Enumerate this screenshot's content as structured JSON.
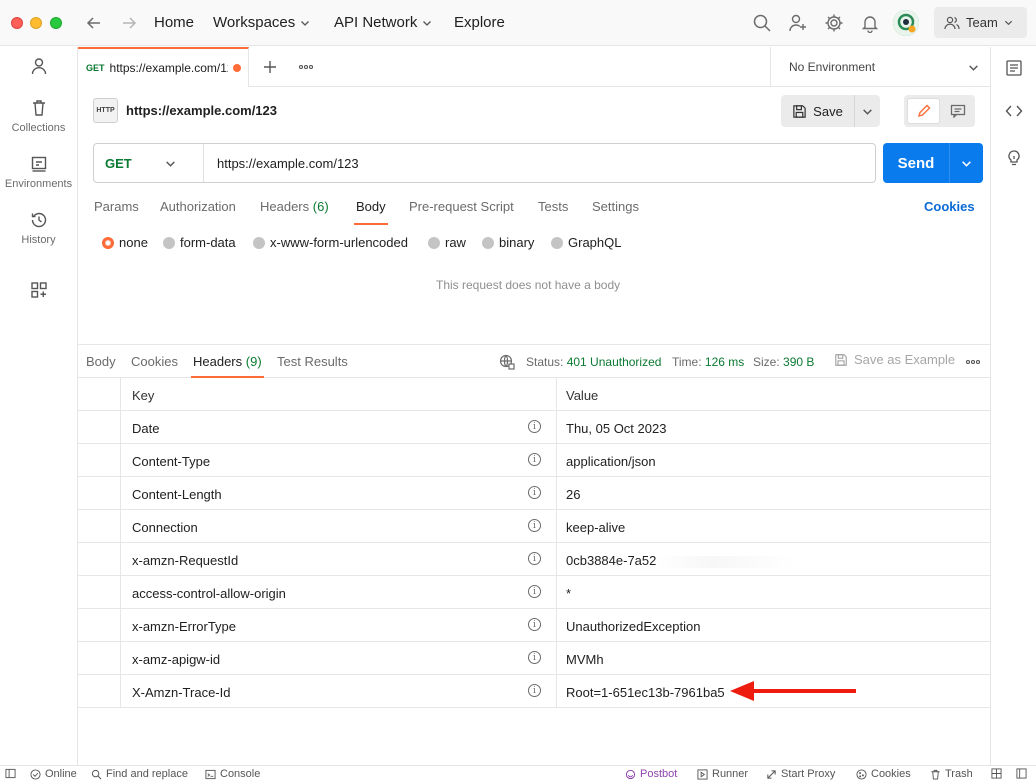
{
  "topbar": {
    "nav": [
      "Home",
      "Workspaces",
      "API Network",
      "Explore"
    ],
    "team_label": "Team"
  },
  "sidebar": {
    "items": [
      {
        "label": "Collections",
        "icon": "trash-bin-icon"
      },
      {
        "label": "Environments",
        "icon": "environment-icon"
      },
      {
        "label": "History",
        "icon": "history-icon"
      }
    ]
  },
  "tabs": {
    "active": {
      "method": "GET",
      "title": "https://example.com/123"
    },
    "environment": "No Environment"
  },
  "request": {
    "title": "https://example.com/123",
    "http_badge": "HTTP",
    "save_label": "Save",
    "method": "GET",
    "url": "https://example.com/123",
    "send_label": "Send",
    "tabs": [
      {
        "label": "Params"
      },
      {
        "label": "Authorization"
      },
      {
        "label": "Headers",
        "count": "(6)"
      },
      {
        "label": "Body"
      },
      {
        "label": "Pre-request Script"
      },
      {
        "label": "Tests"
      },
      {
        "label": "Settings"
      }
    ],
    "active_tab": "Body",
    "cookies_link": "Cookies",
    "body_types": [
      "none",
      "form-data",
      "x-www-form-urlencoded",
      "raw",
      "binary",
      "GraphQL"
    ],
    "selected_body_type": "none",
    "empty_body_message": "This request does not have a body"
  },
  "response": {
    "tabs": [
      {
        "label": "Body"
      },
      {
        "label": "Cookies"
      },
      {
        "label": "Headers",
        "count": "(9)"
      },
      {
        "label": "Test Results"
      }
    ],
    "active_tab": "Headers",
    "status_label": "Status:",
    "status_value": "401 Unauthorized",
    "time_label": "Time:",
    "time_value": "126 ms",
    "size_label": "Size:",
    "size_value": "390 B",
    "save_example_label": "Save as Example",
    "headers": {
      "col_key": "Key",
      "col_value": "Value",
      "rows": [
        {
          "key": "Date",
          "value": "Thu, 05 Oct 2023"
        },
        {
          "key": "Content-Type",
          "value": "application/json"
        },
        {
          "key": "Content-Length",
          "value": "26"
        },
        {
          "key": "Connection",
          "value": "keep-alive"
        },
        {
          "key": "x-amzn-RequestId",
          "value": "0cb3884e-7a52"
        },
        {
          "key": "access-control-allow-origin",
          "value": "*"
        },
        {
          "key": "x-amzn-ErrorType",
          "value": "UnauthorizedException"
        },
        {
          "key": "x-amz-apigw-id",
          "value": "MVMh"
        },
        {
          "key": "X-Amzn-Trace-Id",
          "value": "Root=1-651ec13b-7961ba5"
        }
      ]
    }
  },
  "statusbar": {
    "online": "Online",
    "find_replace": "Find and replace",
    "console": "Console",
    "postbot": "Postbot",
    "runner": "Runner",
    "start_proxy": "Start Proxy",
    "cookies": "Cookies",
    "trash": "Trash"
  },
  "colors": {
    "accent": "#ff6c37",
    "send": "#097bed",
    "success_green": "#0b7a32",
    "annotation_arrow": "#ee1c0e"
  }
}
